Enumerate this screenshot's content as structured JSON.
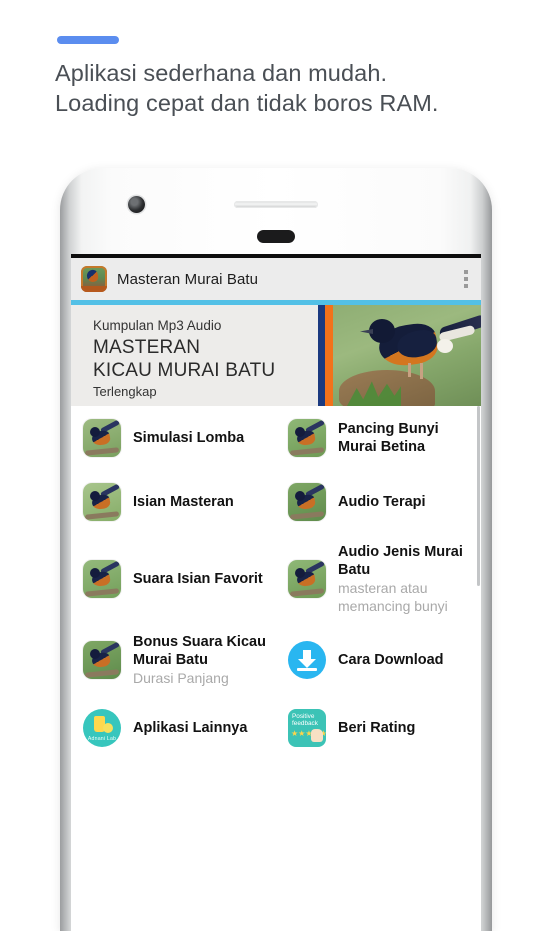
{
  "page": {
    "headline": "Aplikasi sederhana dan mudah.\nLoading cepat dan tidak boros RAM.",
    "accent_color": "#5b8def",
    "background_color": "#ffffff"
  },
  "phone": {
    "camera_icon": "front-camera",
    "speaker_icon": "earpiece-speaker",
    "sensor_icon": "proximity-sensor"
  },
  "app": {
    "appbar": {
      "title": "Masteran Murai Batu",
      "icon": "app-logo-icon",
      "overflow_icon": "overflow-menu-icon",
      "background_color": "#ececec",
      "accent_line_color": "#53c0e6"
    },
    "banner": {
      "eyebrow": "Kumpulan Mp3 Audio",
      "title": "MASTERAN\nKICAU MURAI BATU",
      "subtitle": "Terlengkap",
      "bar_navy": "#1b3a80",
      "bar_orange": "#f2721b",
      "photo_icon": "murai-batu-bird-photo"
    },
    "menu": [
      {
        "title": "Simulasi Lomba",
        "subtitle": "",
        "icon": "bird-thumbnail-icon"
      },
      {
        "title": "Pancing Bunyi\nMurai Betina",
        "subtitle": "",
        "icon": "bird-thumbnail-icon"
      },
      {
        "title": "Isian Masteran",
        "subtitle": "",
        "icon": "bird-thumbnail-icon"
      },
      {
        "title": "Audio Terapi",
        "subtitle": "",
        "icon": "bird-thumbnail-icon"
      },
      {
        "title": "Suara Isian Favorit",
        "subtitle": "",
        "icon": "bird-thumbnail-icon"
      },
      {
        "title": "Audio Jenis Murai\nBatu",
        "subtitle": "masteran atau\nmemancing bunyi",
        "icon": "bird-thumbnail-icon"
      },
      {
        "title": "Bonus Suara Kicau\nMurai Batu",
        "subtitle": "Durasi Panjang",
        "icon": "bird-thumbnail-icon"
      },
      {
        "title": "Cara Download",
        "subtitle": "",
        "icon": "download-icon"
      },
      {
        "title": "Aplikasi Lainnya",
        "subtitle": "",
        "icon": "adnani-lab-logo-icon"
      },
      {
        "title": "Beri Rating",
        "subtitle": "",
        "icon": "positive-feedback-icon"
      }
    ],
    "icons": {
      "download_circle_color": "#29b6f0",
      "lab_logo_color": "#37c6bd",
      "lab_logo_text": "Adnani Lab",
      "rating_badge_color": "#3cc3b6",
      "rating_badge_text": "Positive\nfeedback",
      "rating_stars": "★★★★★"
    }
  }
}
